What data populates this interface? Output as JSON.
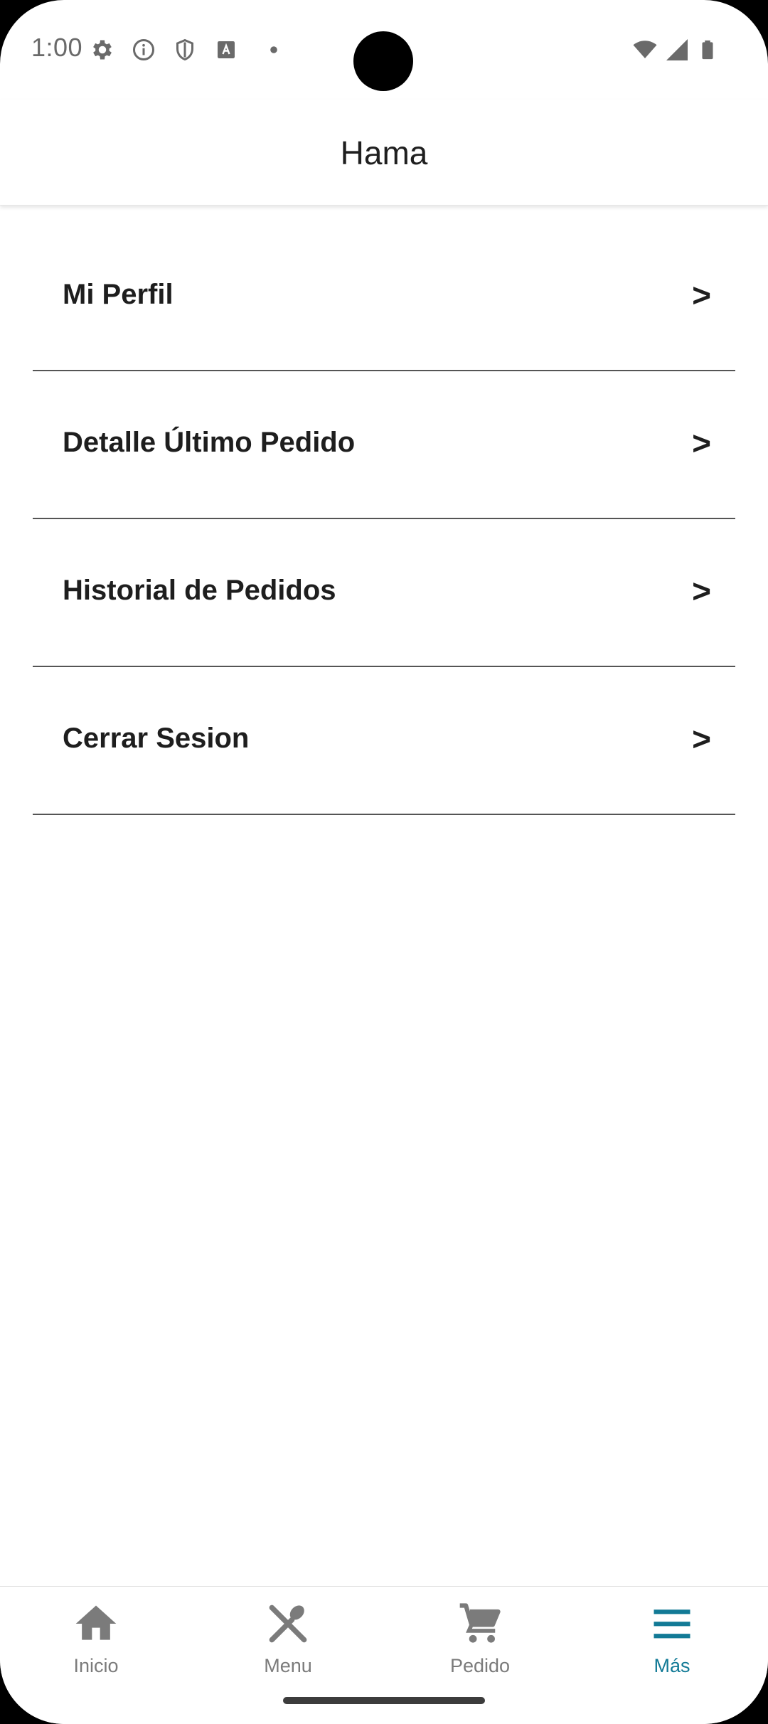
{
  "status_bar": {
    "time": "1:00",
    "left_icons": [
      "settings-icon",
      "info-icon",
      "shield-icon",
      "text-a-icon",
      "dot-icon"
    ],
    "right_icons": [
      "wifi-icon",
      "cellular-signal-icon",
      "battery-icon"
    ]
  },
  "app_bar": {
    "title": "Hama"
  },
  "menu": {
    "items": [
      {
        "label": "Mi Perfil",
        "chevron": ">"
      },
      {
        "label": "Detalle Último Pedido",
        "chevron": ">"
      },
      {
        "label": "Historial de Pedidos",
        "chevron": ">"
      },
      {
        "label": "Cerrar Sesion",
        "chevron": ">"
      }
    ]
  },
  "bottom_nav": {
    "items": [
      {
        "label": "Inicio",
        "icon": "home-icon",
        "active": false
      },
      {
        "label": "Menu",
        "icon": "utensils-icon",
        "active": false
      },
      {
        "label": "Pedido",
        "icon": "cart-icon",
        "active": false
      },
      {
        "label": "Más",
        "icon": "menu-icon",
        "active": true
      }
    ],
    "active_color": "#127a96",
    "inactive_color": "#7b7b7b"
  }
}
